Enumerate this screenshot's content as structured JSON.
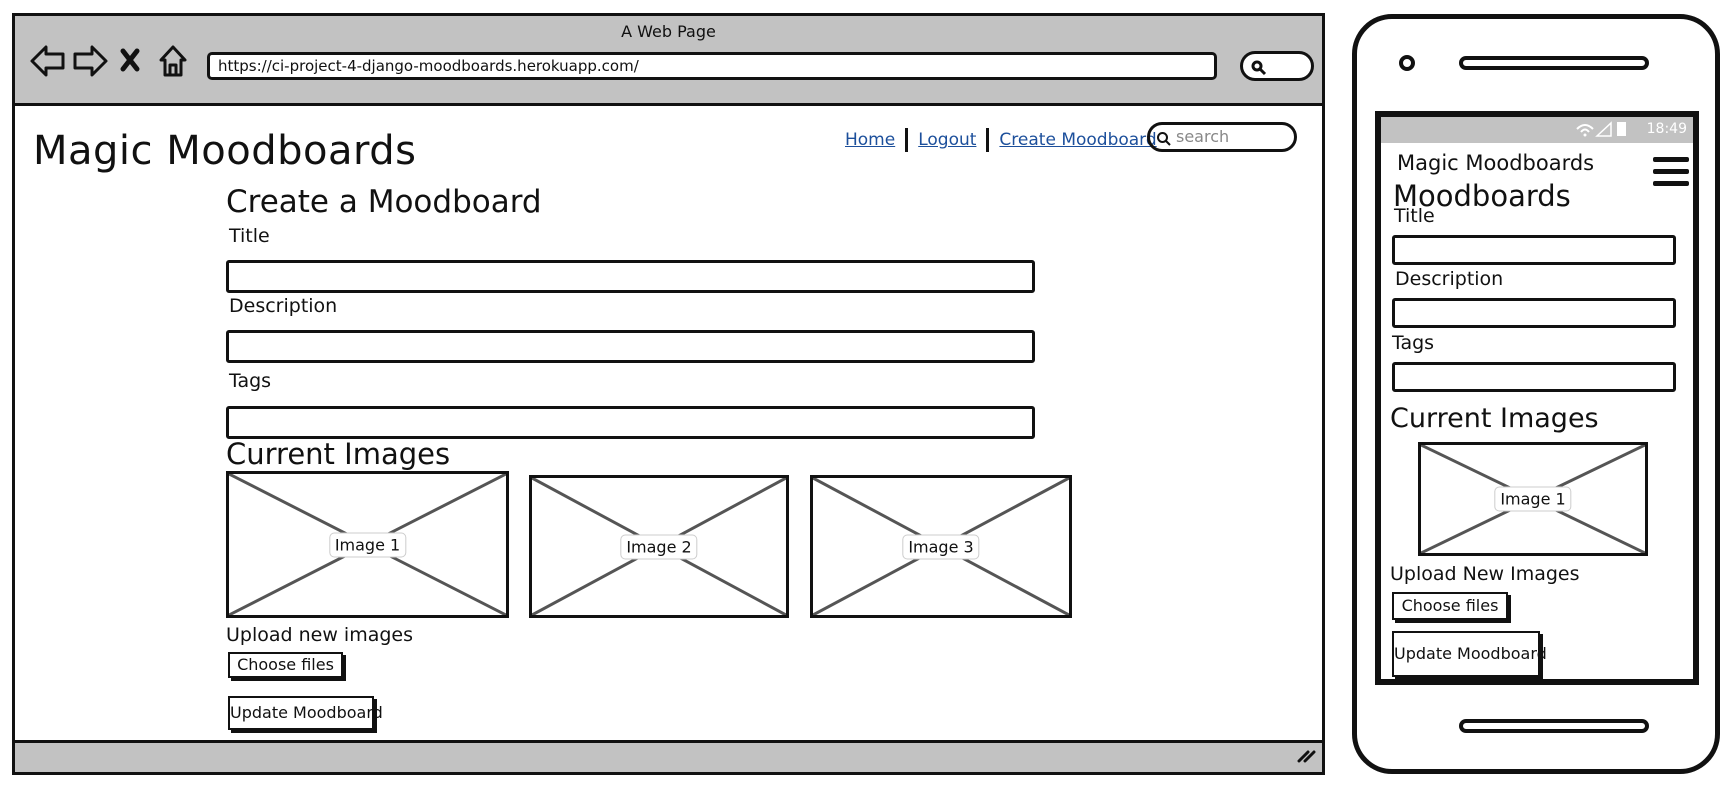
{
  "desktop": {
    "window_title": "A Web Page",
    "url": "https://ci-project-4-django-moodboards.herokuapp.com/",
    "brand": "Magic Moodboards",
    "nav": {
      "home": "Home",
      "logout": "Logout",
      "create": "Create Moodboard",
      "search_placeholder": "search"
    },
    "form": {
      "heading": "Create a Moodboard",
      "title_label": "Title",
      "description_label": "Description",
      "tags_label": "Tags",
      "current_images_heading": "Current Images",
      "images": [
        "Image 1",
        "Image 2",
        "Image 3"
      ],
      "upload_label": "Upload new images",
      "choose_files": "Choose files",
      "submit": "Update Moodboard"
    }
  },
  "mobile": {
    "status_time": "18:49",
    "brand": "Magic Moodboards",
    "heading": "Moodboards",
    "title_label": "Title",
    "description_label": "Description",
    "tags_label": "Tags",
    "current_images_heading": "Current Images",
    "image": "Image 1",
    "upload_label": "Upload New Images",
    "choose_files": "Choose files",
    "submit": "Update Moodboard"
  }
}
